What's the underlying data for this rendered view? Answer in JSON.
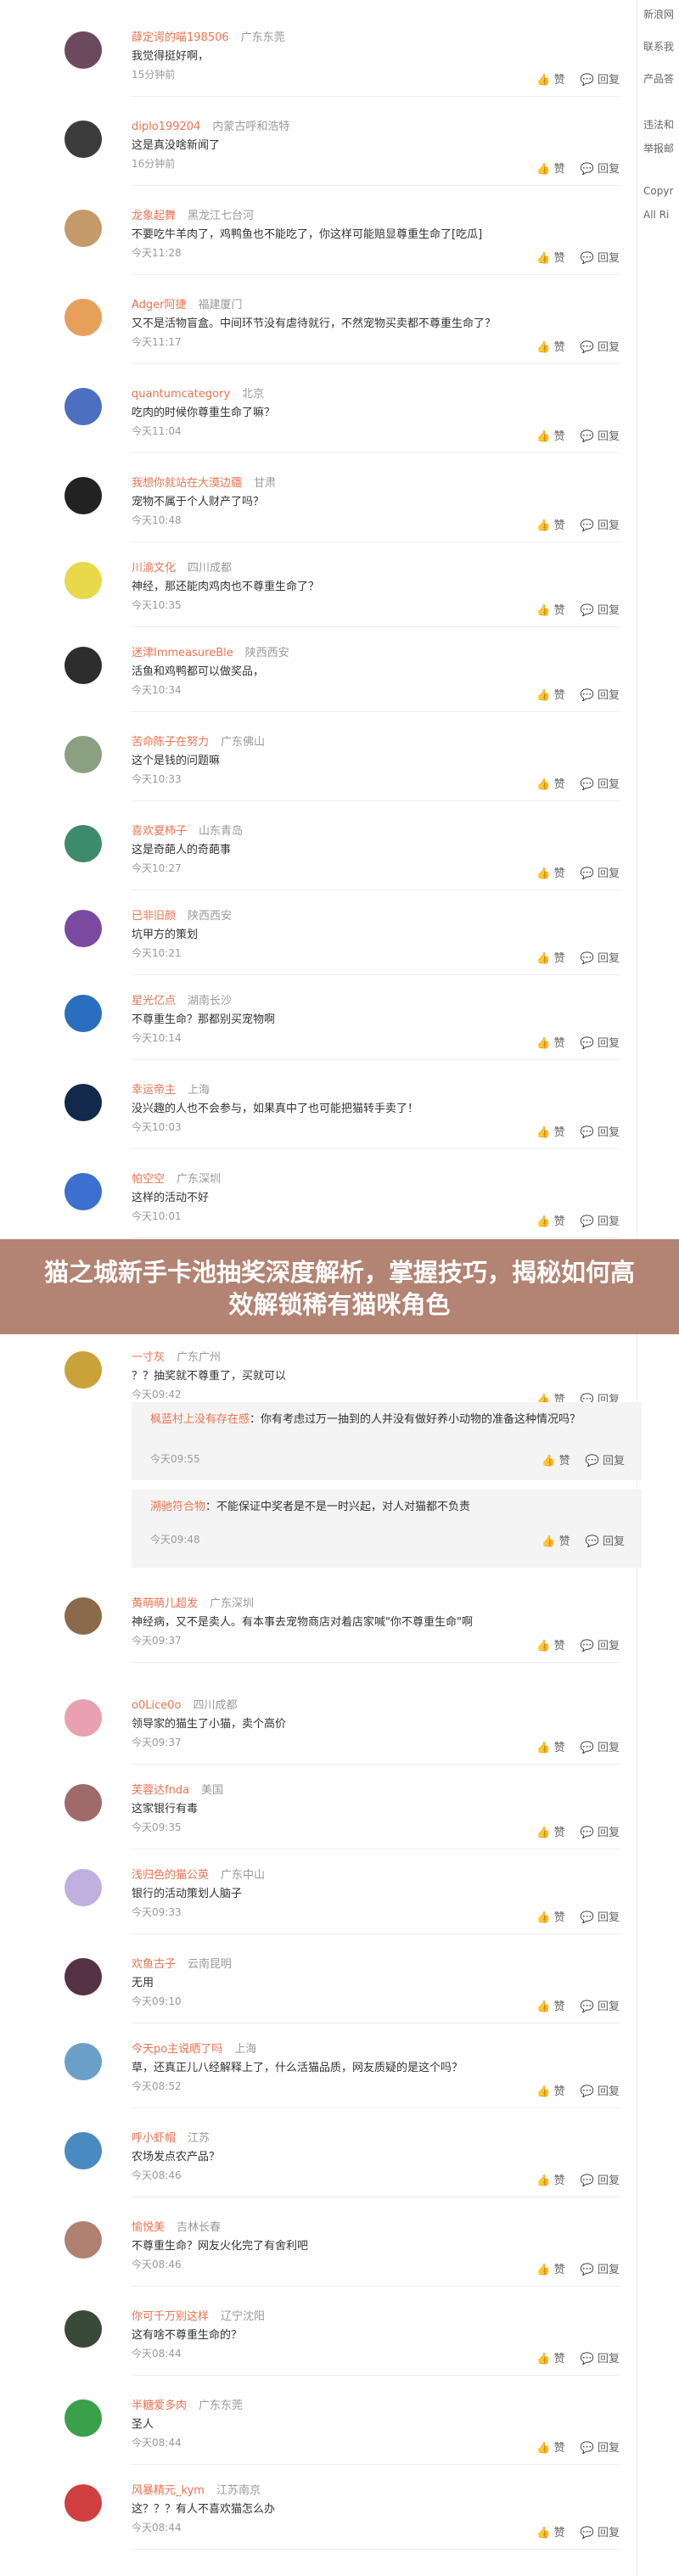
{
  "sidebar_right": {
    "items": [
      "新浪网",
      "联系我",
      "产品答",
      "违法和",
      "举报邮",
      "Copyr",
      "All Ri"
    ]
  },
  "banner": {
    "title": "猫之城新手卡池抽奖深度解析，掌握技巧，揭秘如何高效解锁稀有猫咪角色"
  },
  "actions": {
    "reply": "回复",
    "like": "赞"
  },
  "comments": [
    {
      "user": "薛定谔的喵198506",
      "location": "广东东莞",
      "text": "我觉得挺好啊，",
      "time": "15分钟前"
    },
    {
      "user": "diplo199204",
      "location": "内蒙古呼和浩特",
      "text": "这是真没啥新闻了",
      "time": "16分钟前"
    },
    {
      "user": "龙象起舞",
      "location": "黑龙江七台河",
      "text": "不要吃牛羊肉了，鸡鸭鱼也不能吃了，你这样可能赔显尊重生命了[吃瓜]",
      "time": "今天11:28"
    },
    {
      "user": "Adger阿捷",
      "location": "福建厦门",
      "text": "又不是活物盲盒。中间环节没有虐待就行，不然宠物买卖都不尊重生命了？",
      "time": "今天11:17"
    },
    {
      "user": "quantumcategory",
      "location": "北京",
      "text": "吃肉的时候你尊重生命了嘛？",
      "time": "今天11:04"
    },
    {
      "user": "我想你就站在大漠边疆",
      "location": "甘肃",
      "text": "宠物不属于个人财产了吗？",
      "time": "今天10:48"
    },
    {
      "user": "川渝文化",
      "location": "四川成都",
      "text": "神经，那还能肉鸡肉也不尊重生命了？",
      "time": "今天10:35"
    },
    {
      "user": "迷津ImmeasureBle",
      "location": "陕西西安",
      "text": "活鱼和鸡鸭都可以做奖品，",
      "time": "今天10:34"
    },
    {
      "user": "苦命陈子在努力",
      "location": "广东佛山",
      "text": "这个是钱的问题嘛",
      "time": "今天10:33"
    },
    {
      "user": "喜欢夏柿子",
      "location": "山东青岛",
      "text": "这是奇葩人的奇葩事",
      "time": "今天10:27"
    },
    {
      "user": "已非旧颜",
      "location": "陕西西安",
      "text": "坑甲方的策划",
      "time": "今天10:21"
    },
    {
      "user": "星光亿点",
      "location": "湖南长沙",
      "text": "不尊重生命？那都别买宠物啊",
      "time": "今天10:14"
    },
    {
      "user": "幸运帝主",
      "location": "上海",
      "text": "没兴趣的人也不会参与，如果真中了也可能把猫转手卖了！",
      "time": "今天10:03"
    },
    {
      "user": "帕空空",
      "location": "广东深圳",
      "text": "这样的活动不好",
      "time": "今天10:01"
    },
    {
      "user": "一寸灰",
      "location": "广东广州",
      "text": "？？抽奖就不尊重了，买就可以",
      "time": "今天09:42"
    },
    {
      "user": "黄萌萌儿超发",
      "location": "广东深圳",
      "text": "神经病，又不是卖人。有本事去宠物商店对着店家喊\"你不尊重生命\"啊",
      "time": "今天09:37"
    },
    {
      "user": "o0Lice0o",
      "location": "四川成都",
      "text": "领导家的猫生了小猫，卖个高价",
      "time": "今天09:37"
    },
    {
      "user": "芙蓉达fnda",
      "location": "美国",
      "text": "这家银行有毒",
      "time": "今天09:35"
    },
    {
      "user": "浅归色的猫公英",
      "location": "广东中山",
      "text": "银行的活动策划人脑子",
      "time": "今天09:33"
    },
    {
      "user": "欢鱼古子",
      "location": "云南昆明",
      "text": "无用",
      "time": "今天09:10"
    },
    {
      "user": "今天po主说晒了吗",
      "location": "上海",
      "text": "草，还真正儿八经解释上了，什么活猫品质，网友质疑的是这个吗？",
      "time": "今天08:52"
    },
    {
      "user": "呼小虾帽",
      "location": "江苏",
      "text": "农场发点农产品？",
      "time": "今天08:46"
    },
    {
      "user": "愉悦美",
      "location": "吉林长春",
      "text": "不尊重生命？网友火化完了有舍利吧",
      "time": "今天08:46"
    },
    {
      "user": "你可千万别这样",
      "location": "辽宁沈阳",
      "text": "这有啥不尊重生命的？",
      "time": "今天08:44"
    },
    {
      "user": "半糖爱多肉",
      "location": "广东东莞",
      "text": "圣人",
      "time": "今天08:44"
    },
    {
      "user": "风暴精元_kym",
      "location": "江苏南京",
      "text": "这？？？有人不喜欢猫怎么办",
      "time": "今天08:44"
    }
  ],
  "replies": [
    {
      "user": "枫蓝村上没有存在感",
      "text": "你有考虑过万一抽到的人并没有做好养小动物的准备这种情况吗？",
      "time": "今天09:55"
    },
    {
      "user": "溯驰符合物",
      "text": "不能保证中奖者是不是一时兴起，对人对猫都不负责",
      "time": "今天09:48"
    }
  ],
  "colors": {
    "username": "#eb7350",
    "banner_bg": "#a87260",
    "text": "#333333",
    "meta": "#999999"
  }
}
